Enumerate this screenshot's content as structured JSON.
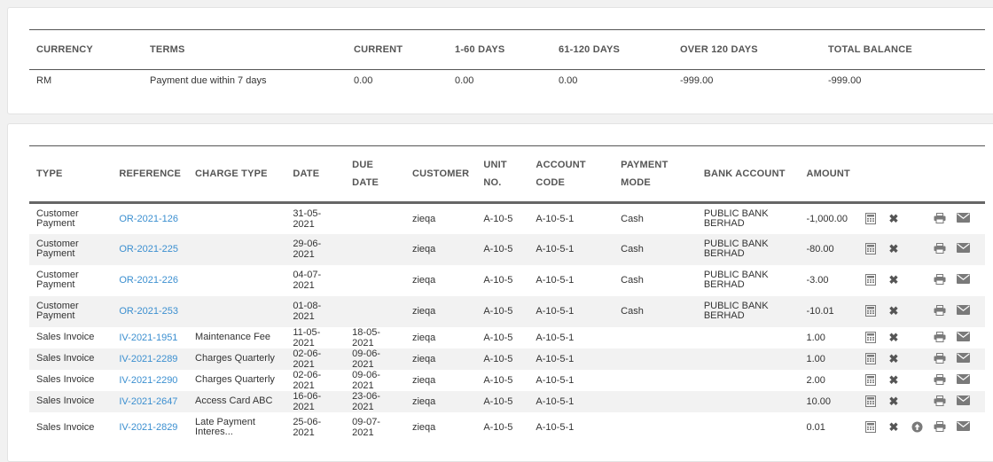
{
  "summary": {
    "headers": [
      "CURRENCY",
      "TERMS",
      "CURRENT",
      "1-60 DAYS",
      "61-120 DAYS",
      "OVER 120 DAYS",
      "TOTAL BALANCE"
    ],
    "row": [
      "RM",
      "Payment due within 7 days",
      "0.00",
      "0.00",
      "0.00",
      "-999.00",
      "-999.00"
    ]
  },
  "transactions": {
    "headers": {
      "type": "TYPE",
      "reference": "REFERENCE",
      "charge_type": "CHARGE TYPE",
      "date": "DATE",
      "due_date_1": "DUE",
      "due_date_2": "DATE",
      "customer": "CUSTOMER",
      "unit_1": "UNIT",
      "unit_2": "NO.",
      "account_1": "ACCOUNT",
      "account_2": "CODE",
      "payment_1": "PAYMENT",
      "payment_2": "MODE",
      "bank_account": "BANK ACCOUNT",
      "amount": "AMOUNT"
    },
    "rows": [
      {
        "type_1": "Customer",
        "type_2": "Payment",
        "reference": "OR-2021-126",
        "charge_1": "",
        "charge_2": "",
        "date": "31-05-2021",
        "due_date": "",
        "customer": "zieqa",
        "unit": "A-10-5",
        "account": "A-10-5-1",
        "payment_mode": "Cash",
        "bank_1": "PUBLIC BANK",
        "bank_2": "BERHAD",
        "amount": "-1,000.00"
      },
      {
        "type_1": "Customer",
        "type_2": "Payment",
        "reference": "OR-2021-225",
        "charge_1": "",
        "charge_2": "",
        "date": "29-06-2021",
        "due_date": "",
        "customer": "zieqa",
        "unit": "A-10-5",
        "account": "A-10-5-1",
        "payment_mode": "Cash",
        "bank_1": "PUBLIC BANK",
        "bank_2": "BERHAD",
        "amount": "-80.00"
      },
      {
        "type_1": "Customer",
        "type_2": "Payment",
        "reference": "OR-2021-226",
        "charge_1": "",
        "charge_2": "",
        "date": "04-07-2021",
        "due_date": "",
        "customer": "zieqa",
        "unit": "A-10-5",
        "account": "A-10-5-1",
        "payment_mode": "Cash",
        "bank_1": "PUBLIC BANK",
        "bank_2": "BERHAD",
        "amount": "-3.00"
      },
      {
        "type_1": "Customer",
        "type_2": "Payment",
        "reference": "OR-2021-253",
        "charge_1": "",
        "charge_2": "",
        "date": "01-08-2021",
        "due_date": "",
        "customer": "zieqa",
        "unit": "A-10-5",
        "account": "A-10-5-1",
        "payment_mode": "Cash",
        "bank_1": "PUBLIC BANK",
        "bank_2": "BERHAD",
        "amount": "-10.01"
      },
      {
        "type_1": "Sales Invoice",
        "type_2": "",
        "reference": "IV-2021-1951",
        "charge_1": "Maintenance Fee",
        "charge_2": "",
        "date": "11-05-2021",
        "due_date": "18-05-2021",
        "customer": "zieqa",
        "unit": "A-10-5",
        "account": "A-10-5-1",
        "payment_mode": "",
        "bank_1": "",
        "bank_2": "",
        "amount": "1.00"
      },
      {
        "type_1": "Sales Invoice",
        "type_2": "",
        "reference": "IV-2021-2289",
        "charge_1": "Charges Quarterly",
        "charge_2": "",
        "date": "02-06-2021",
        "due_date": "09-06-2021",
        "customer": "zieqa",
        "unit": "A-10-5",
        "account": "A-10-5-1",
        "payment_mode": "",
        "bank_1": "",
        "bank_2": "",
        "amount": "1.00"
      },
      {
        "type_1": "Sales Invoice",
        "type_2": "",
        "reference": "IV-2021-2290",
        "charge_1": "Charges Quarterly",
        "charge_2": "",
        "date": "02-06-2021",
        "due_date": "09-06-2021",
        "customer": "zieqa",
        "unit": "A-10-5",
        "account": "A-10-5-1",
        "payment_mode": "",
        "bank_1": "",
        "bank_2": "",
        "amount": "2.00"
      },
      {
        "type_1": "Sales Invoice",
        "type_2": "",
        "reference": "IV-2021-2647",
        "charge_1": "Access Card ABC",
        "charge_2": "",
        "date": "16-06-2021",
        "due_date": "23-06-2021",
        "customer": "zieqa",
        "unit": "A-10-5",
        "account": "A-10-5-1",
        "payment_mode": "",
        "bank_1": "",
        "bank_2": "",
        "amount": "10.00"
      },
      {
        "type_1": "Sales Invoice",
        "type_2": "",
        "reference": "IV-2021-2829",
        "charge_1": "Late Payment",
        "charge_2": "Interes...",
        "date": "25-06-2021",
        "due_date": "09-07-2021",
        "customer": "zieqa",
        "unit": "A-10-5",
        "account": "A-10-5-1",
        "payment_mode": "",
        "bank_1": "",
        "bank_2": "",
        "amount": "0.01"
      }
    ],
    "row_icons": [
      "calculator-icon",
      "close-icon",
      "upload-icon",
      "print-icon",
      "email-icon"
    ]
  },
  "colors": {
    "link": "#3b8fd0",
    "icon": "#7a7a7a",
    "stripe": "#f2f2f2"
  }
}
